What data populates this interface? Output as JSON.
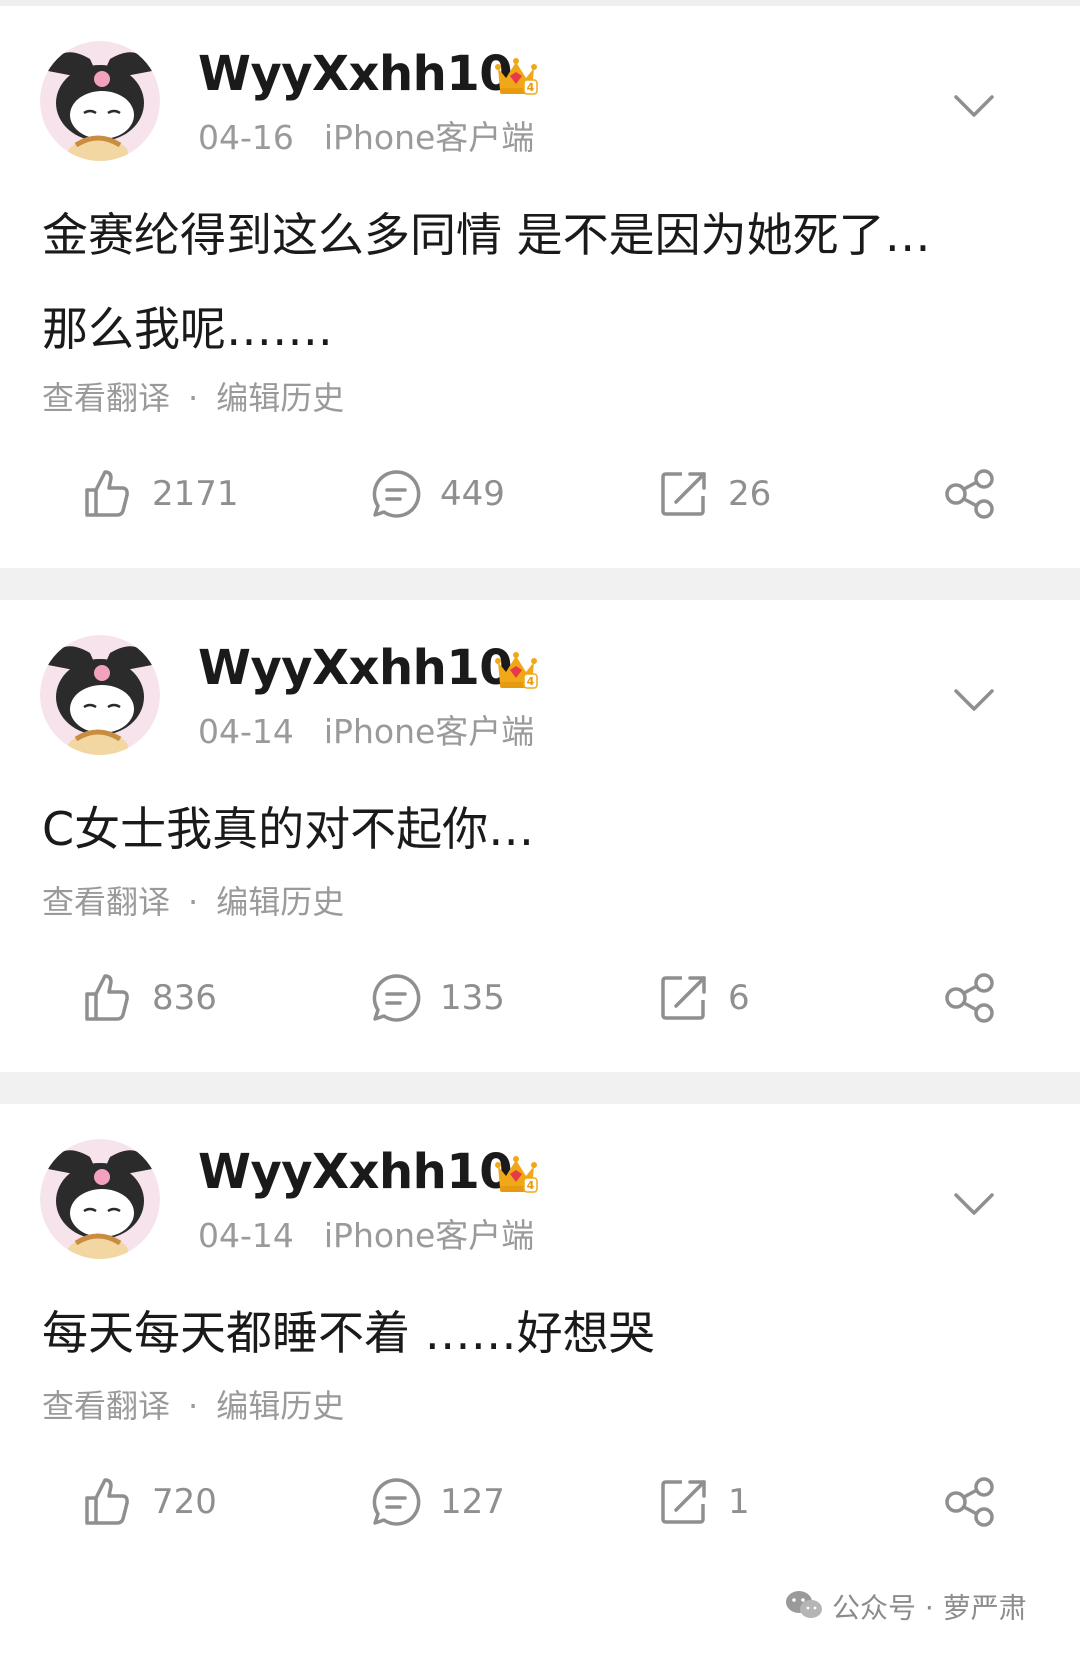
{
  "colors": {
    "text_primary": "#1a1a1a",
    "text_secondary": "#9a9a9a",
    "separator": "#f1f1f1",
    "icon_gray": "#8f8f8f",
    "badge_gold": "#f0a818",
    "badge_red": "#e8394a"
  },
  "posts": [
    {
      "username": "WyyXxhh10",
      "badge_level": "4",
      "date": "04-16",
      "source": "iPhone客户端",
      "content_lines": [
        "金赛纶得到这么多同情 是不是因为她死了…",
        "那么我呢……."
      ],
      "translate_label": "查看翻译",
      "edit_history_label": "编辑历史",
      "separator_dot": "·",
      "likes": "2171",
      "comments": "449",
      "reposts": "26"
    },
    {
      "username": "WyyXxhh10",
      "badge_level": "4",
      "date": "04-14",
      "source": "iPhone客户端",
      "content_lines": [
        "C女士我真的对不起你…"
      ],
      "translate_label": "查看翻译",
      "edit_history_label": "编辑历史",
      "separator_dot": "·",
      "likes": "836",
      "comments": "135",
      "reposts": "6"
    },
    {
      "username": "WyyXxhh10",
      "badge_level": "4",
      "date": "04-14",
      "source": "iPhone客户端",
      "content_lines": [
        "每天每天都睡不着 ……好想哭"
      ],
      "translate_label": "查看翻译",
      "edit_history_label": "编辑历史",
      "separator_dot": "·",
      "likes": "720",
      "comments": "127",
      "reposts": "1"
    }
  ],
  "watermark": {
    "text": "公众号 · 萝严肃",
    "icon": "wechat-icon"
  }
}
